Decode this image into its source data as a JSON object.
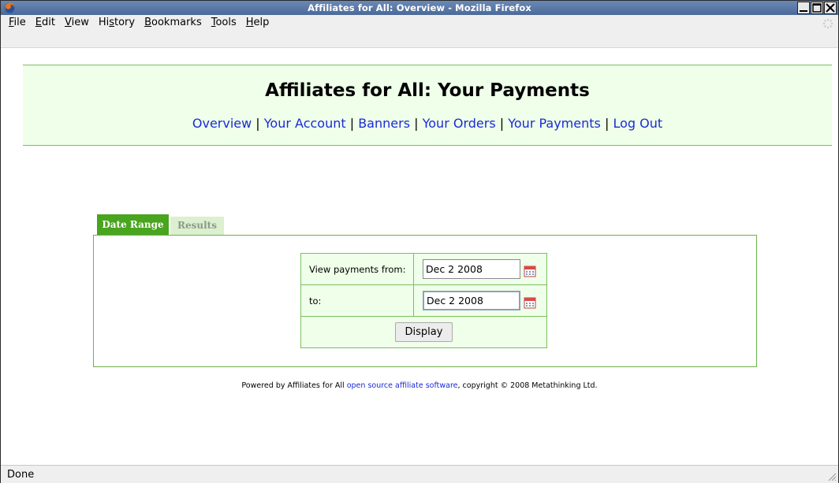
{
  "window": {
    "title": "Affiliates for All: Overview - Mozilla Firefox",
    "controls": [
      "minimize",
      "maximize",
      "close"
    ]
  },
  "menu": {
    "items": [
      "File",
      "Edit",
      "View",
      "History",
      "Bookmarks",
      "Tools",
      "Help"
    ]
  },
  "page": {
    "heading": "Affiliates for All: Your Payments",
    "nav": [
      "Overview",
      "Your Account",
      "Banners",
      "Your Orders",
      "Your Payments",
      "Log Out"
    ],
    "nav_separator": "|"
  },
  "tabs": {
    "active": "Date Range",
    "inactive": "Results"
  },
  "form": {
    "from_label": "View payments from:",
    "from_value": "Dec 2 2008",
    "to_label": "to:",
    "to_value": "Dec 2 2008",
    "submit_label": "Display"
  },
  "footer": {
    "prefix": "Powered by Affiliates for All ",
    "link_text": "open source affiliate software",
    "suffix": ", copyright © 2008 Metathinking Ltd."
  },
  "status": {
    "text": "Done"
  },
  "colors": {
    "titlebar": "#4b6a99",
    "header_bg": "#efffe9",
    "green_border": "#7bbf5f",
    "tab_active": "#49a41f",
    "link": "#1a2bd6"
  }
}
